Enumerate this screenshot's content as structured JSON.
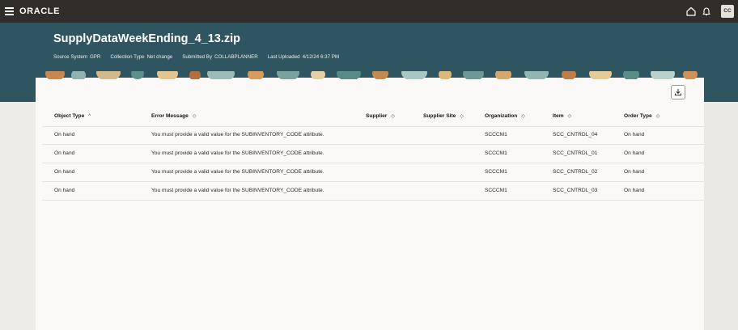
{
  "header": {
    "logo": "ORACLE",
    "avatar": "CC"
  },
  "page": {
    "title": "SupplyDataWeekEnding_4_13.zip",
    "meta": [
      {
        "label": "Source System",
        "value": "GPR"
      },
      {
        "label": "Collection Type",
        "value": "Net change"
      },
      {
        "label": "Submitted By",
        "value": "COLLABPLANNER"
      },
      {
        "label": "Last Uploaded",
        "value": "4/12/24 6:37 PM"
      }
    ]
  },
  "table": {
    "columns": [
      {
        "label": "Object Type",
        "sort": "^"
      },
      {
        "label": "Error Message",
        "sort": "◇"
      },
      {
        "label": "Supplier",
        "sort": "◇"
      },
      {
        "label": "Supplier Site",
        "sort": "◇"
      },
      {
        "label": "Organization",
        "sort": "◇"
      },
      {
        "label": "Item",
        "sort": "◇"
      },
      {
        "label": "Order Type",
        "sort": "◇"
      }
    ],
    "rows": [
      [
        "On hand",
        "You must provide a valid value for the SUBINVENTORY_CODE attribute.",
        "",
        "",
        "SCCCM1",
        "SCC_CNTRDL_04",
        "On hand"
      ],
      [
        "On hand",
        "You must provide a valid value for the SUBINVENTORY_CODE attribute.",
        "",
        "",
        "SCCCM1",
        "SCC_CNTRDL_01",
        "On hand"
      ],
      [
        "On hand",
        "You must provide a valid value for the SUBINVENTORY_CODE attribute.",
        "",
        "",
        "SCCCM1",
        "SCC_CNTRDL_02",
        "On hand"
      ],
      [
        "On hand",
        "You must provide a valid value for the SUBINVENTORY_CODE attribute.",
        "",
        "",
        "SCCCM1",
        "SCC_CNTRDL_03",
        "On hand"
      ]
    ]
  }
}
